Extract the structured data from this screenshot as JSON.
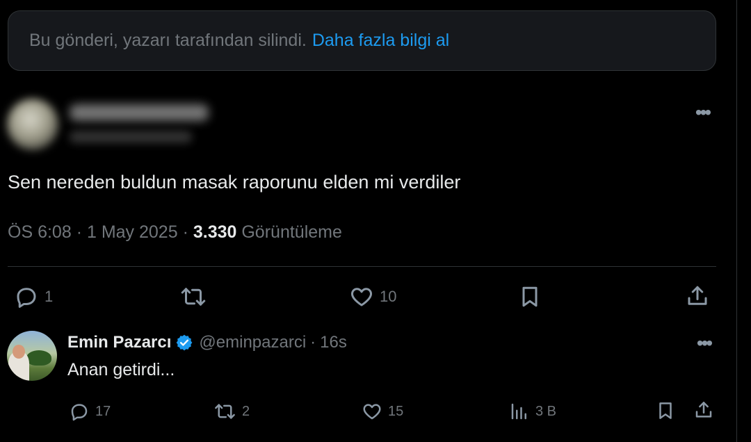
{
  "deleted_notice": {
    "text": "Bu gönderi, yazarı tarafından silindi.",
    "link": "Daha fazla bilgi al"
  },
  "main_tweet": {
    "text": "Sen nereden buldun masak raporunu elden mi verdiler",
    "time": "ÖS 6:08",
    "date": "1 May 2025",
    "views_count": "3.330",
    "views_label": "Görüntüleme",
    "separator": "·",
    "actions": {
      "reply_count": "1",
      "retweet_count": "",
      "like_count": "10"
    }
  },
  "reply_tweet": {
    "name": "Emin Pazarcı",
    "handle": "@eminpazarci",
    "time": "16s",
    "text": "Anan getirdi...",
    "actions": {
      "reply_count": "17",
      "retweet_count": "2",
      "like_count": "15",
      "views_count": "3 B"
    }
  },
  "icons": {
    "more": "more-dots-icon",
    "reply": "reply-bubble-icon",
    "retweet": "retweet-icon",
    "like": "heart-icon",
    "bookmark": "bookmark-icon",
    "share": "share-upload-icon",
    "views": "views-bars-icon",
    "verified": "verified-badge-icon"
  },
  "colors": {
    "background": "#000000",
    "link": "#1d9bf0",
    "muted_text": "#71767b",
    "primary_text": "#e7e9ea",
    "verified": "#1d9bf0"
  }
}
